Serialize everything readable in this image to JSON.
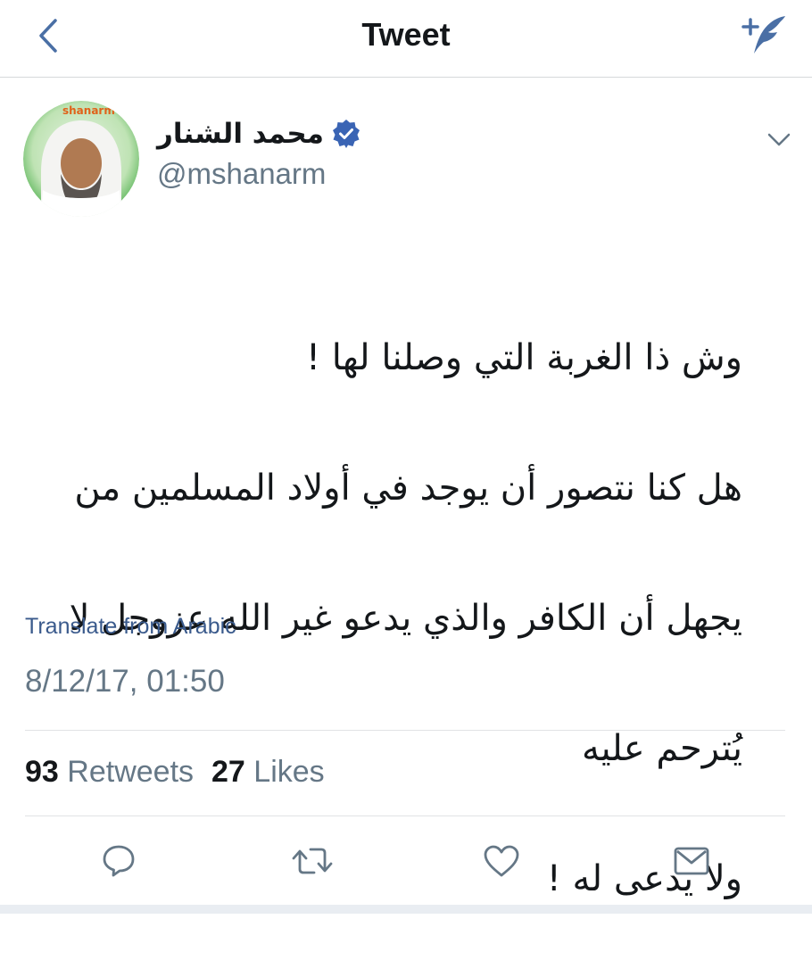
{
  "nav": {
    "title": "Tweet",
    "back_icon": "chevron-left-icon",
    "compose_icon": "compose-tweet-icon"
  },
  "author": {
    "name": "محمد الشنار",
    "handle": "@mshanarm",
    "verified": true,
    "avatar_label": "shanarm"
  },
  "tweet": {
    "lines": [
      "وش ذا الغربة التي وصلنا لها !",
      "هل كنا نتصور أن يوجد في أولاد المسلمين من",
      "يجهل أن الكافر والذي يدعو غير الله عزوجل لا",
      "يُترحم عليه",
      "ولا يدعى له !"
    ],
    "translate_label": "Translate from Arabic",
    "timestamp": "8/12/17, 01:50"
  },
  "stats": {
    "retweets_count": "93",
    "retweets_label": "Retweets",
    "likes_count": "27",
    "likes_label": "Likes"
  },
  "actions": [
    "reply-icon",
    "retweet-icon",
    "like-icon",
    "share-icon"
  ],
  "colors": {
    "accent": "#1da1f2",
    "icon": "#657786",
    "link": "#3a5a8c",
    "nav_icon": "#4a6fa5",
    "avatar_ring": "#5cb85c"
  }
}
